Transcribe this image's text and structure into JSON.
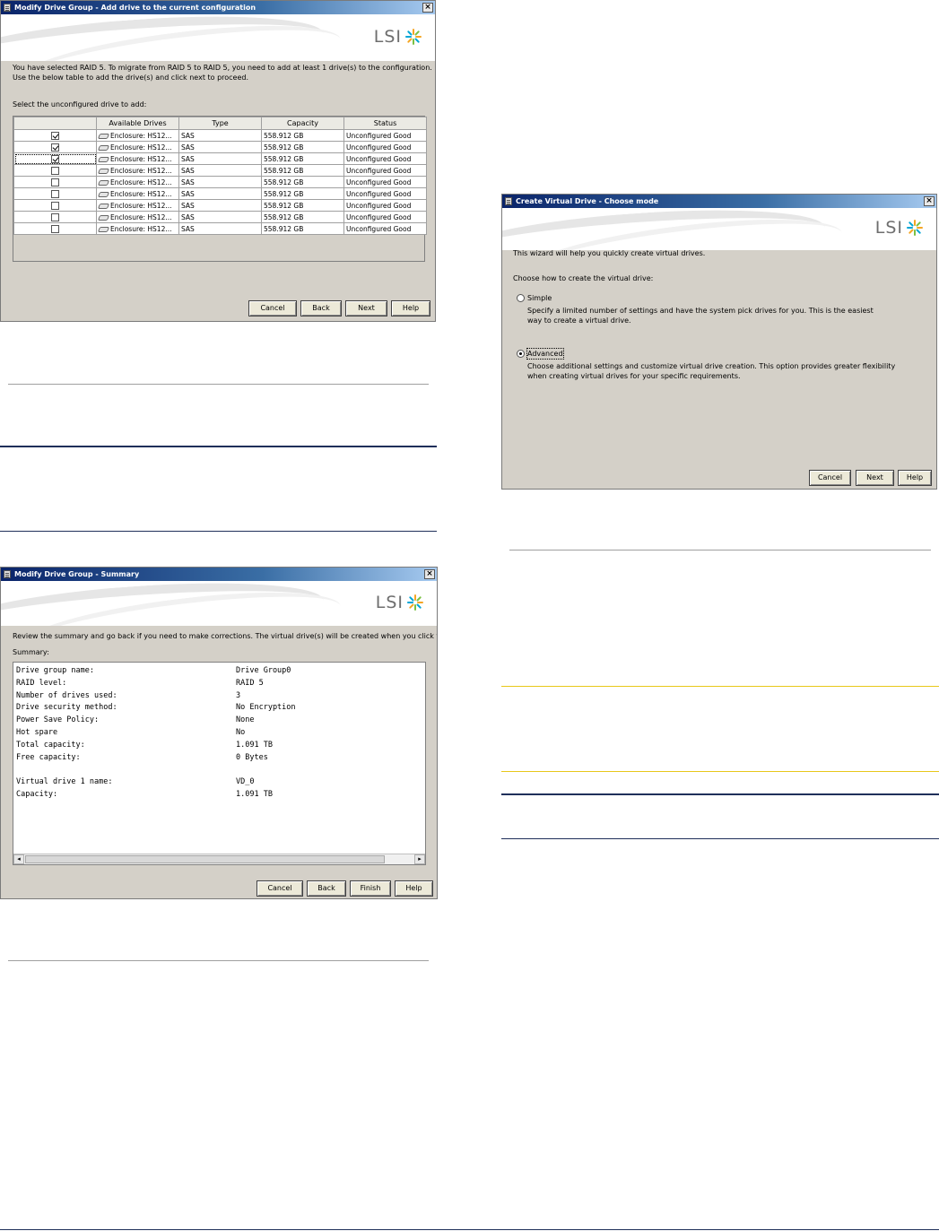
{
  "dialog_add": {
    "title": "Modify Drive Group - Add drive to the current configuration",
    "logo": "LSI",
    "intro_line1": "You have selected RAID 5. To migrate from RAID 5 to RAID 5, you need to add at least 1 drive(s) to the configuration.",
    "intro_line2": "Use the below table to add the drive(s) and click next to proceed.",
    "select_label": "Select the unconfigured drive to add:",
    "columns": [
      "",
      "Available Drives",
      "Type",
      "Capacity",
      "Status"
    ],
    "rows": [
      {
        "checked": true,
        "drive": "Enclosure: HS12...",
        "type": "SAS",
        "capacity": "558.912 GB",
        "status": "Unconfigured Good"
      },
      {
        "checked": true,
        "drive": "Enclosure: HS12...",
        "type": "SAS",
        "capacity": "558.912 GB",
        "status": "Unconfigured Good"
      },
      {
        "checked": true,
        "drive": "Enclosure: HS12...",
        "type": "SAS",
        "capacity": "558.912 GB",
        "status": "Unconfigured Good"
      },
      {
        "checked": false,
        "drive": "Enclosure: HS12...",
        "type": "SAS",
        "capacity": "558.912 GB",
        "status": "Unconfigured Good"
      },
      {
        "checked": false,
        "drive": "Enclosure: HS12...",
        "type": "SAS",
        "capacity": "558.912 GB",
        "status": "Unconfigured Good"
      },
      {
        "checked": false,
        "drive": "Enclosure: HS12...",
        "type": "SAS",
        "capacity": "558.912 GB",
        "status": "Unconfigured Good"
      },
      {
        "checked": false,
        "drive": "Enclosure: HS12...",
        "type": "SAS",
        "capacity": "558.912 GB",
        "status": "Unconfigured Good"
      },
      {
        "checked": false,
        "drive": "Enclosure: HS12...",
        "type": "SAS",
        "capacity": "558.912 GB",
        "status": "Unconfigured Good"
      },
      {
        "checked": false,
        "drive": "Enclosure: HS12...",
        "type": "SAS",
        "capacity": "558.912 GB",
        "status": "Unconfigured Good"
      }
    ],
    "buttons": {
      "cancel": "Cancel",
      "back": "Back",
      "next": "Next",
      "help": "Help"
    }
  },
  "dialog_create": {
    "title": "Create Virtual Drive - Choose mode",
    "logo": "LSI",
    "intro": "This wizard will help you quickly create virtual drives.",
    "prompt": "Choose how to create the virtual drive:",
    "simple_label": "Simple",
    "simple_desc": "Specify a limited number of settings and have the system pick drives for you. This is the easiest way to create a virtual drive.",
    "advanced_label": "Advanced",
    "advanced_desc": "Choose additional settings and customize virtual drive creation. This option provides greater flexibility when creating virtual drives for your specific requirements.",
    "selected_mode": "Advanced",
    "buttons": {
      "cancel": "Cancel",
      "next": "Next",
      "help": "Help"
    }
  },
  "dialog_summary": {
    "title": "Modify Drive Group - Summary",
    "logo": "LSI",
    "intro": "Review the summary and go back if you need to make corrections. The virtual drive(s) will be created when you click finish.",
    "summary_label": "Summary:",
    "items": [
      {
        "label": "Drive group name:",
        "value": "Drive Group0"
      },
      {
        "label": "RAID level:",
        "value": "RAID 5"
      },
      {
        "label": "Number of drives used:",
        "value": "3"
      },
      {
        "label": "Drive security method:",
        "value": "No Encryption"
      },
      {
        "label": "Power Save Policy:",
        "value": "None"
      },
      {
        "label": "Hot spare",
        "value": "No"
      },
      {
        "label": "Total capacity:",
        "value": "1.091 TB"
      },
      {
        "label": "Free capacity:",
        "value": "0 Bytes"
      },
      {
        "label": "Virtual drive 1 name:",
        "value": "VD_0"
      },
      {
        "label": "Capacity:",
        "value": "1.091 TB"
      }
    ],
    "buttons": {
      "cancel": "Cancel",
      "back": "Back",
      "finish": "Finish",
      "help": "Help"
    }
  },
  "colors": {
    "dialog_bg": "#d4d0c8",
    "titlebar": "#0a246a",
    "rule_gray": "#a0a0a0",
    "rule_navy": "#1f2f5a",
    "rule_yellow": "#e8c81a"
  }
}
